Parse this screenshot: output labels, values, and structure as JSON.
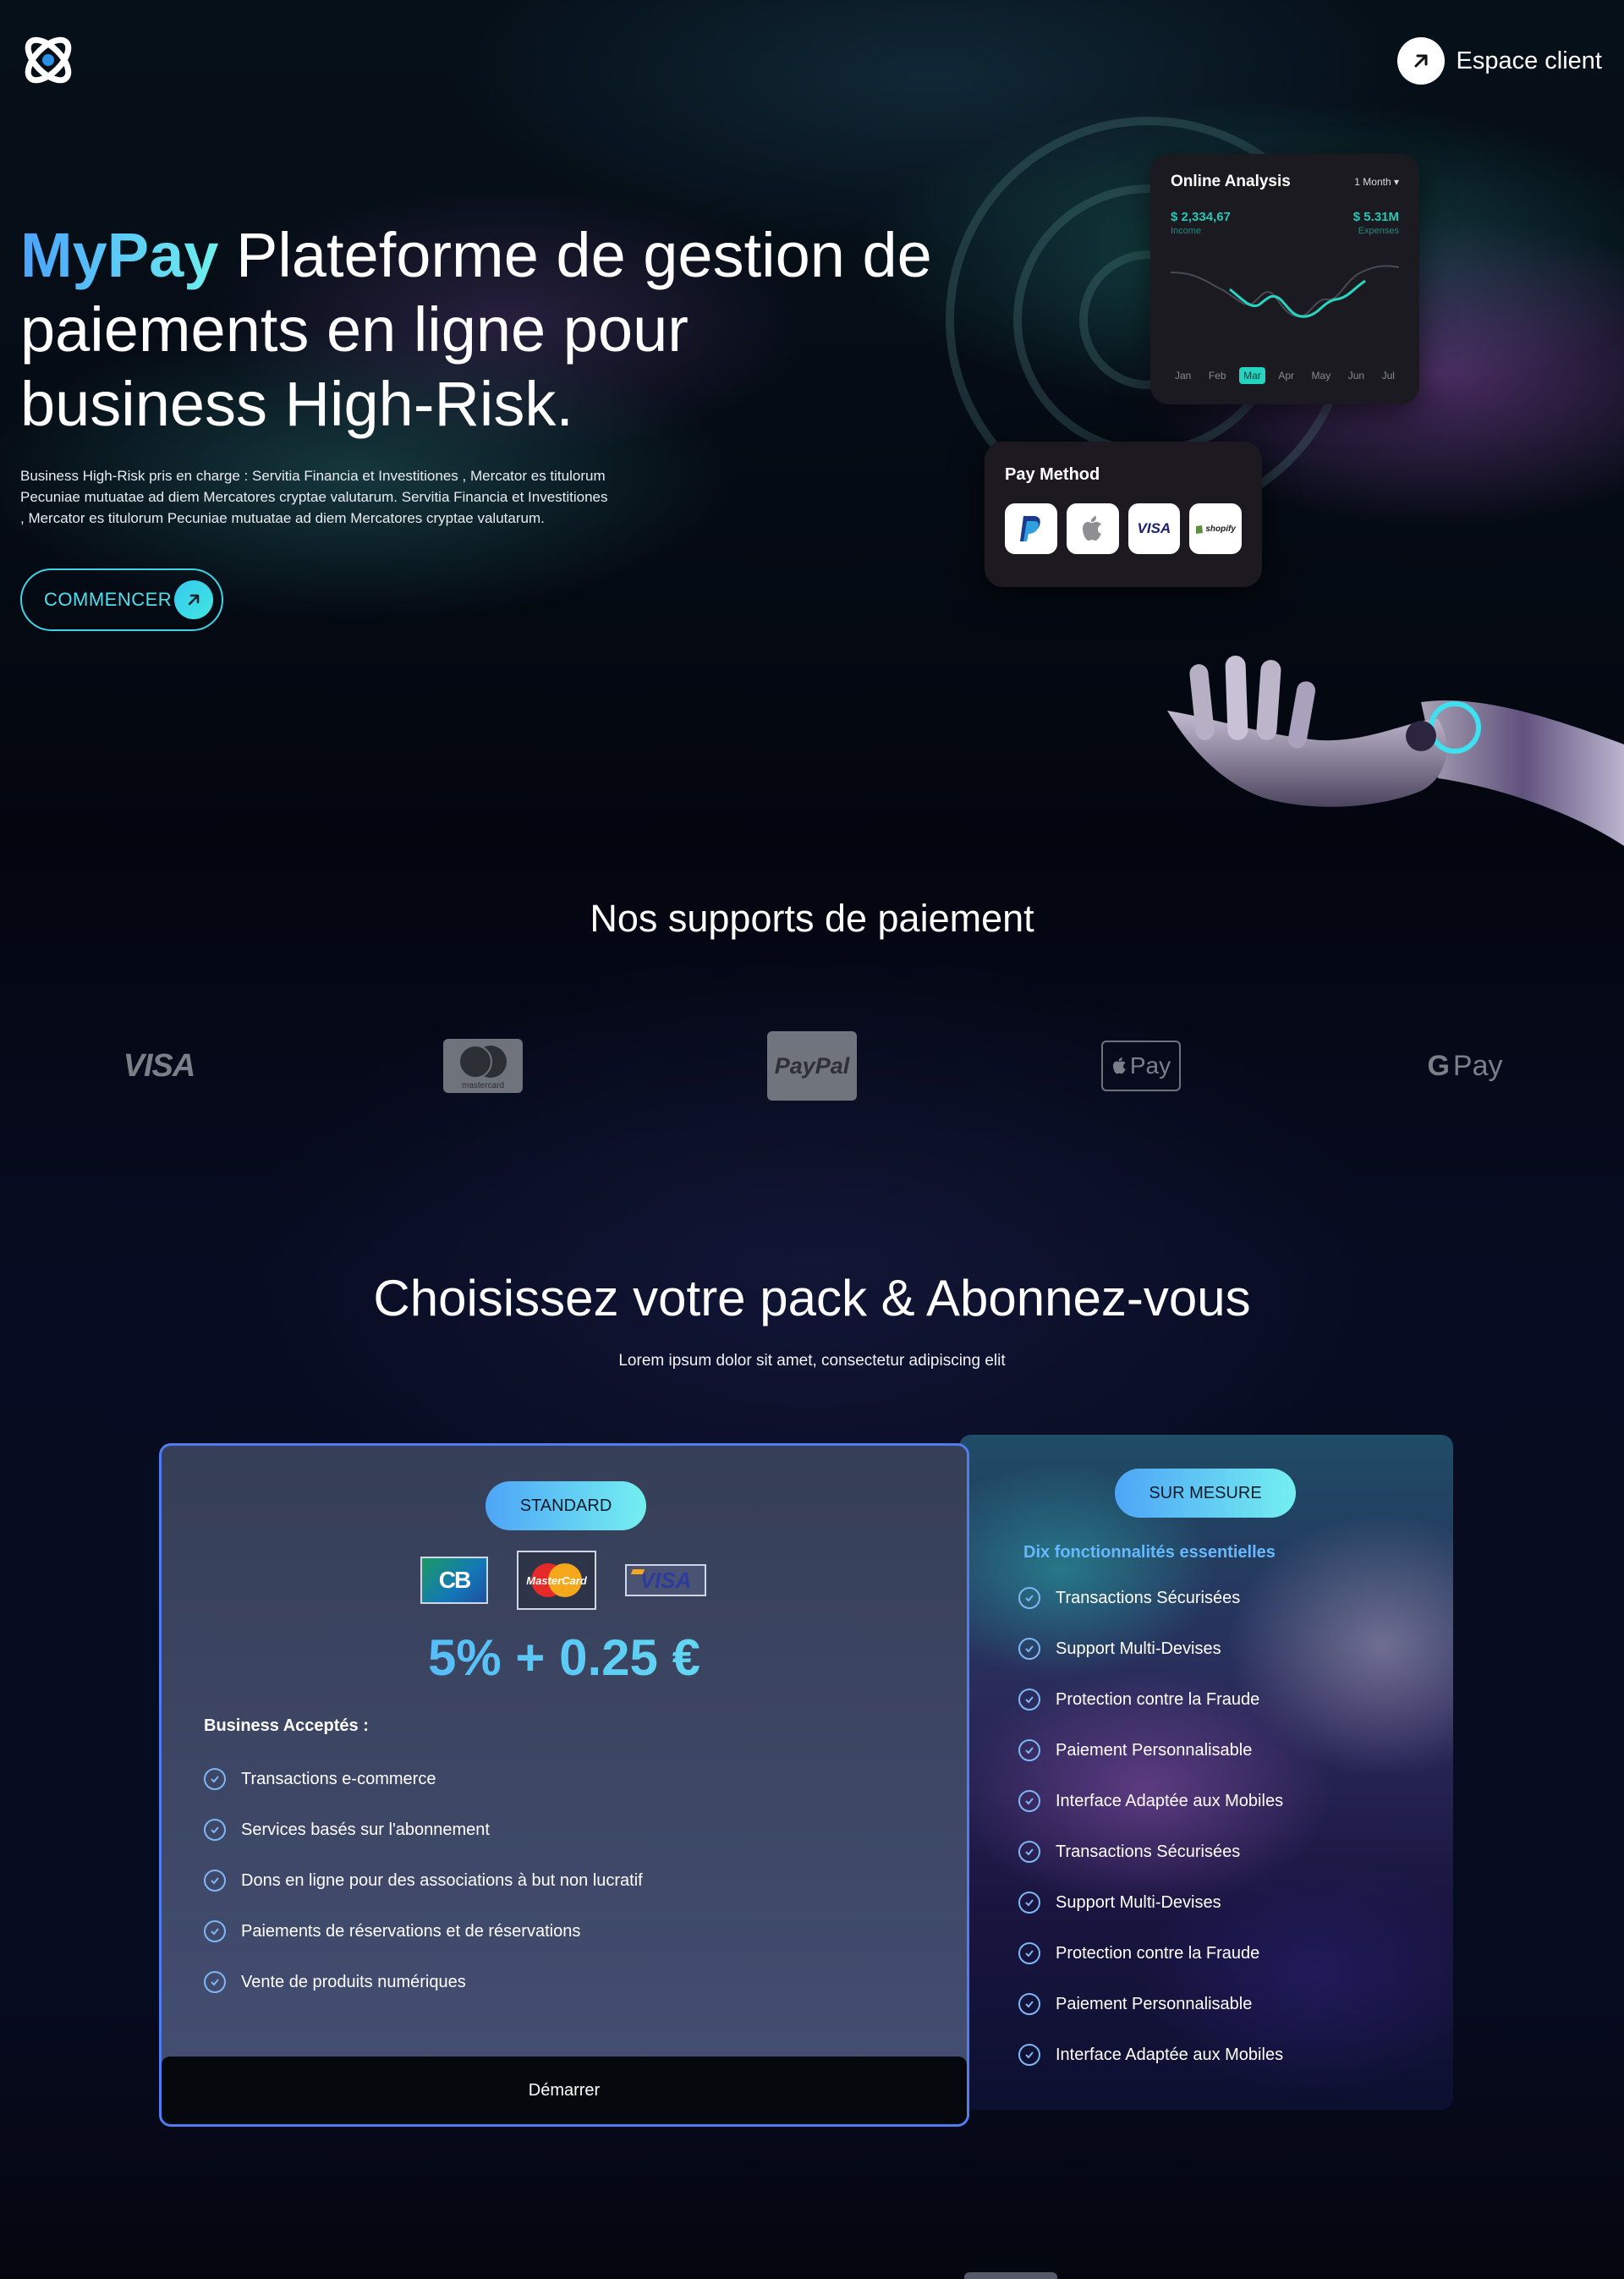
{
  "header": {
    "logo_icon": "atom-logo-icon",
    "client_link_label": "Espace client"
  },
  "hero": {
    "brand": "MyPay",
    "title_rest": " Plateforme de gestion de paiements en ligne pour business High-Risk.",
    "description": "Business High-Risk pris en charge : Servitia Financia et Investitiones , Mercator es titulorum Pecuniae mutuatae ad diem Mercatores cryptae valutarum. Servitia Financia et Investitiones , Mercator es titulorum Pecuniae mutuatae ad diem Mercatores cryptae valutarum.",
    "cta_label": "COMMENCER"
  },
  "analysis_card": {
    "title": "Online Analysis",
    "period": "1 Month",
    "income_value": "$ 2,334,67",
    "income_label": "Income",
    "expenses_value": "$ 5.31M",
    "expenses_label": "Expenses",
    "months": [
      "Jan",
      "Feb",
      "Mar",
      "Apr",
      "May",
      "Jun",
      "Jul"
    ],
    "active_month": "Mar",
    "accent_color": "#24d4c0"
  },
  "pay_card": {
    "title": "Pay Method",
    "methods": [
      "paypal",
      "apple",
      "visa",
      "shopify"
    ],
    "visa_text": "VISA",
    "shopify_text": "shopify"
  },
  "supports": {
    "title": "Nos supports de paiement",
    "logos": [
      {
        "name": "visa",
        "text": "VISA"
      },
      {
        "name": "mastercard",
        "text": "mastercard"
      },
      {
        "name": "paypal",
        "text": "PayPal"
      },
      {
        "name": "apple-pay",
        "text": "Pay"
      },
      {
        "name": "google-pay",
        "text": "Pay"
      }
    ]
  },
  "packs": {
    "title": "Choisissez votre pack & Abonnez-vous",
    "subtitle": "Lorem ipsum dolor sit amet, consectetur adipiscing elit",
    "standard": {
      "badge": "STANDARD",
      "card_logos": [
        "CB",
        "MasterCard",
        "VISA"
      ],
      "price": "5% + 0.25 €",
      "accepted_title": "Business Acceptés :",
      "features": [
        "Transactions e-commerce",
        "Services basés sur l'abonnement",
        "Dons en ligne pour des associations à but non lucratif",
        "Paiements de réservations et de réservations",
        "Vente de produits numériques"
      ],
      "button_label": "Démarrer",
      "border_color": "#4f7cf0"
    },
    "custom": {
      "badge": "SUR MESURE",
      "features_title": "Dix fonctionnalités essentielles",
      "features": [
        "Transactions Sécurisées",
        "Support Multi-Devises",
        "Protection contre la Fraude",
        "Paiement Personnalisable",
        "Interface Adaptée aux Mobiles",
        "Transactions Sécurisées",
        "Support Multi-Devises",
        "Protection contre la Fraude",
        "Paiement Personnalisable",
        "Interface Adaptée aux Mobiles"
      ]
    }
  },
  "colors": {
    "brand_gradient_start": "#4aa3ff",
    "brand_gradient_end": "#6ef0ec",
    "cta_border": "#3fd3e6",
    "background": "#03060f"
  }
}
